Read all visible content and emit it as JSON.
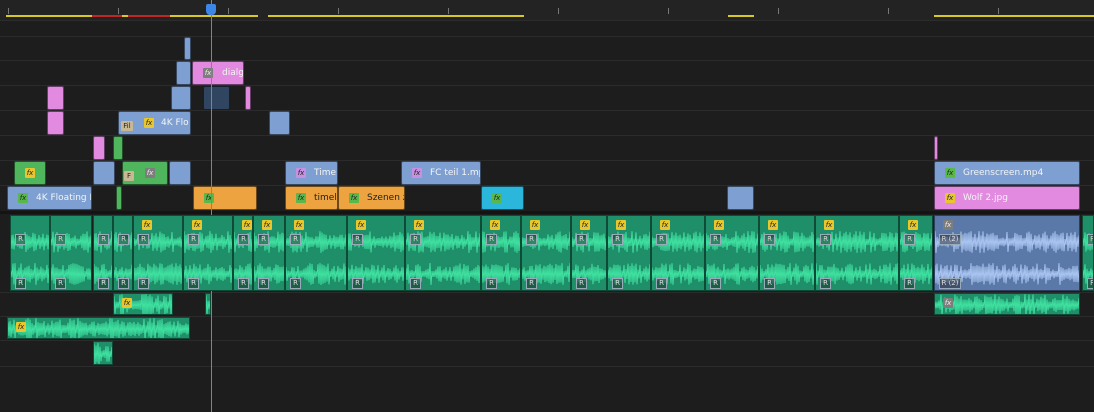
{
  "timeline": {
    "video_clips": [
      {
        "name": "clip-dialg",
        "label": "dialg",
        "fx": "fx"
      },
      {
        "name": "clip-4k-flo",
        "label": "4K Flo",
        "fx": "fx",
        "badge": "Fil"
      },
      {
        "name": "clip-4k-floating",
        "label": "4K Floating P",
        "fx": "fx"
      },
      {
        "name": "clip-time",
        "label": "Time",
        "fx": "fx"
      },
      {
        "name": "clip-timel",
        "label": "timel",
        "fx": "fx"
      },
      {
        "name": "clip-szenen",
        "label": "Szenen z",
        "fx": "fx"
      },
      {
        "name": "clip-fc-teil",
        "label": "FC teil 1.mp",
        "fx": "fx"
      },
      {
        "name": "clip-greenscreen",
        "label": "Greenscreen.mp4",
        "fx": "fx"
      },
      {
        "name": "clip-wolf",
        "label": "Wolf 2.jpg",
        "fx": "fx"
      },
      {
        "name": "clip-small-green",
        "label": "",
        "fx": "fx"
      },
      {
        "name": "clip-small-f",
        "label": "",
        "fx": "fx",
        "badge": "F"
      }
    ],
    "audio": {
      "fx_label": "fx",
      "r_label": "R",
      "r2_label": "R (2)"
    },
    "colors": {
      "video_blue": "#7d9fd2",
      "video_pink": "#e18ae0",
      "video_green": "#4fb65e",
      "video_orange": "#eca340",
      "video_cyan": "#2bb6dc",
      "audio_green": "#1f8f6a",
      "playhead": "#4a8fe0",
      "work_area": "#d8c72b",
      "render_red": "#c22525"
    }
  }
}
